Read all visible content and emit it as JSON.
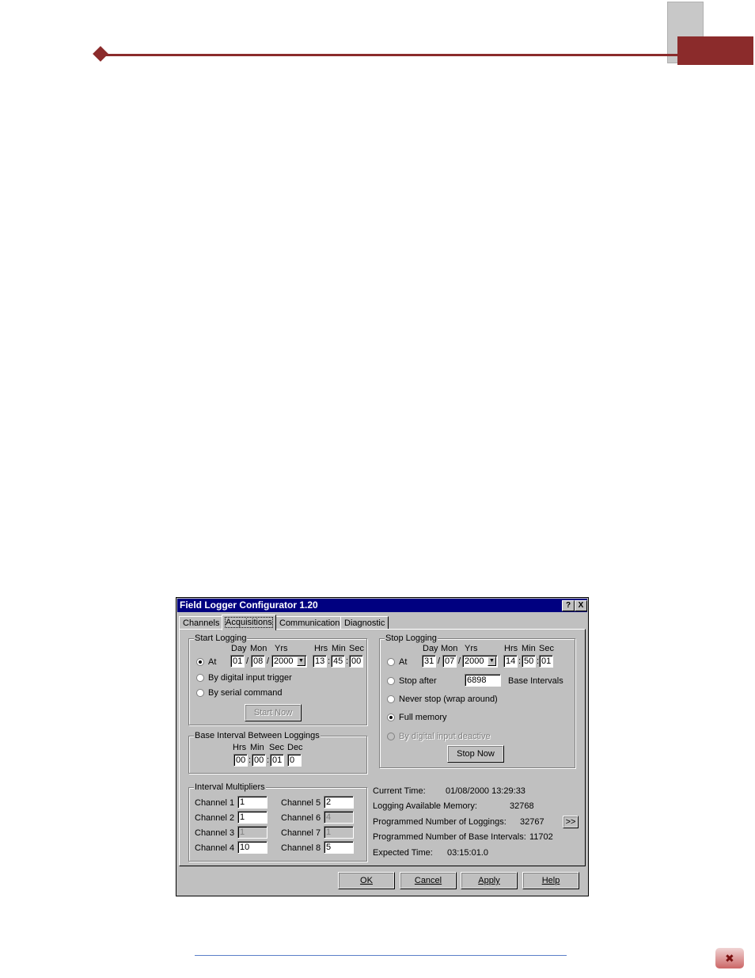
{
  "dialog": {
    "title": "Field Logger Configurator 1.20",
    "help_button": "?",
    "close_button": "X",
    "tabs": [
      "Channels",
      "Acquisitions",
      "Communication",
      "Diagnostic"
    ],
    "start_logging": {
      "title": "Start Logging",
      "col_day": "Day",
      "col_mon": "Mon",
      "col_yrs": "Yrs",
      "col_hrs": "Hrs",
      "col_min": "Min",
      "col_sec": "Sec",
      "at_label": "At",
      "day": "01",
      "mon": "08",
      "yrs": "2000",
      "hrs": "13",
      "min": "45",
      "sec": "00",
      "sep_slash": "/",
      "sep_colon": ":",
      "opt_digital": "By digital input trigger",
      "opt_serial": "By serial command",
      "start_now": "Start Now"
    },
    "base_interval": {
      "title": "Base Interval Between Loggings",
      "col_hrs": "Hrs",
      "col_min": "Min",
      "col_sec": "Sec",
      "col_dec": "Dec",
      "hrs": "00",
      "min": "00",
      "sec": "01",
      "dec": "0"
    },
    "interval_multipliers": {
      "title": "Interval Multipliers",
      "channels": [
        {
          "label": "Channel 1",
          "value": "1"
        },
        {
          "label": "Channel 2",
          "value": "1"
        },
        {
          "label": "Channel 3",
          "value": "1"
        },
        {
          "label": "Channel 4",
          "value": "10"
        },
        {
          "label": "Channel 5",
          "value": "2"
        },
        {
          "label": "Channel 6",
          "value": "4"
        },
        {
          "label": "Channel 7",
          "value": "1"
        },
        {
          "label": "Channel 8",
          "value": "5"
        }
      ]
    },
    "stop_logging": {
      "title": "Stop Logging",
      "col_day": "Day",
      "col_mon": "Mon",
      "col_yrs": "Yrs",
      "col_hrs": "Hrs",
      "col_min": "Min",
      "col_sec": "Sec",
      "at_label": "At",
      "day": "31",
      "mon": "07",
      "yrs": "2000",
      "hrs": "14",
      "min": "50",
      "sec": "01",
      "opt_stop_after": "Stop after",
      "stop_after_value": "6898",
      "base_intervals": "Base Intervals",
      "opt_never": "Never stop (wrap around)",
      "opt_full": "Full memory",
      "opt_digital": "By digital input deactive",
      "stop_now": "Stop Now"
    },
    "info": {
      "current_time_label": "Current Time:",
      "current_time_value": "01/08/2000  13:29:33",
      "memory_label": "Logging Available Memory:",
      "memory_value": "32768",
      "prog_loggings_label": "Programmed Number of Loggings:",
      "prog_loggings_value": "32767",
      "more_button": ">>",
      "prog_base_label": "Programmed Number of Base Intervals:",
      "prog_base_value": "11702",
      "expected_label": "Expected Time:",
      "expected_value": "03:15:01.0"
    },
    "buttons": {
      "ok": "OK",
      "cancel": "Cancel",
      "apply": "Apply",
      "help": "Help"
    }
  },
  "colors": {
    "accent": "#8b2b2b",
    "titlebar": "#000080",
    "face": "#c0c0c0"
  }
}
